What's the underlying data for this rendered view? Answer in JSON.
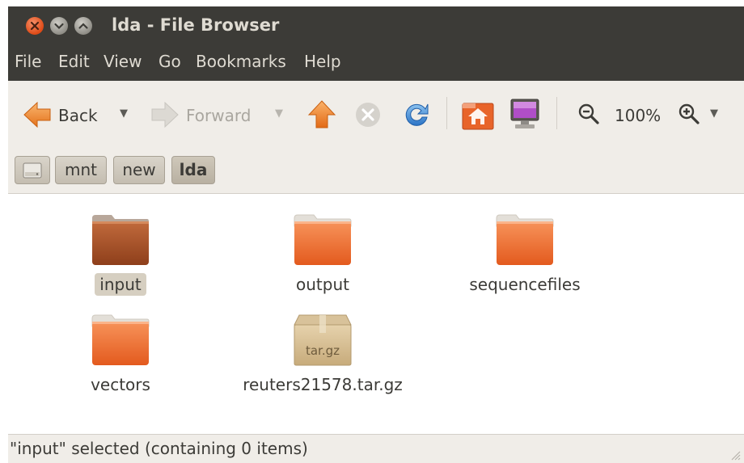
{
  "window": {
    "title": "lda - File Browser"
  },
  "menubar": {
    "items": [
      "File",
      "Edit",
      "View",
      "Go",
      "Bookmarks",
      "Help"
    ]
  },
  "toolbar": {
    "back_label": "Back",
    "forward_label": "Forward",
    "zoom_level": "100%"
  },
  "breadcrumbs": [
    "mnt",
    "new",
    "lda"
  ],
  "files": [
    {
      "name": "input",
      "type": "folder",
      "selected": true
    },
    {
      "name": "output",
      "type": "folder"
    },
    {
      "name": "sequencefiles",
      "type": "folder"
    },
    {
      "name": "vectors",
      "type": "folder"
    },
    {
      "name": "reuters21578.tar.gz",
      "type": "archive",
      "badge": "tar.gz"
    }
  ],
  "status": {
    "text": "\"input\" selected (containing 0 items)"
  },
  "colors": {
    "titlebar": "#3c3b37",
    "folder_orange": "#e96b2d",
    "selection": "#d6cfc1"
  }
}
